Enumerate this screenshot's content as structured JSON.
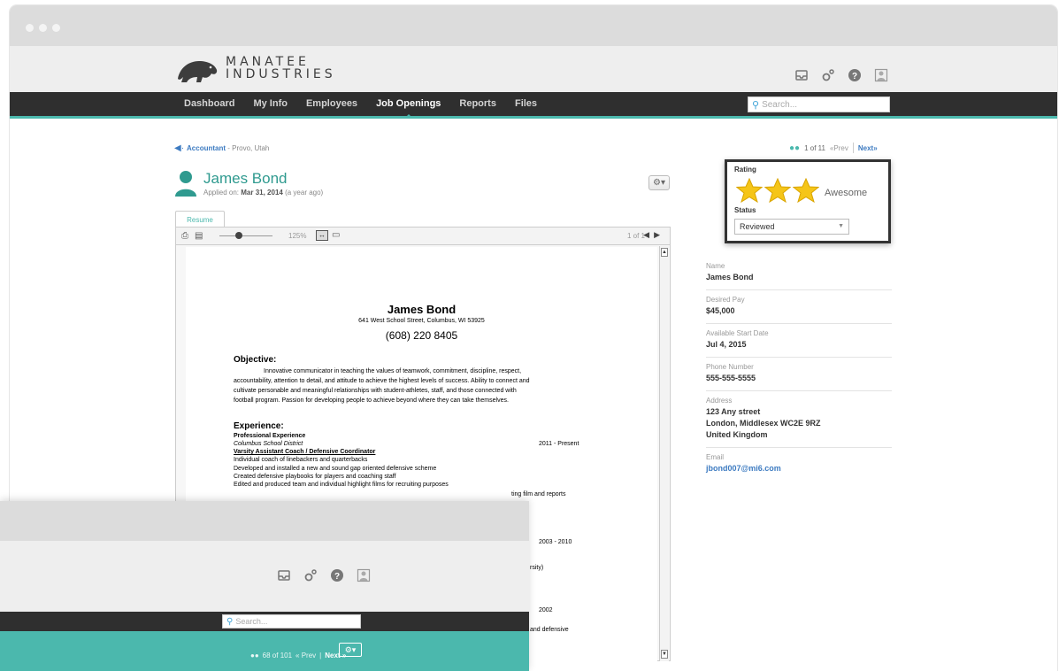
{
  "app": {
    "brand_top": "MANATEE",
    "brand_bottom": "INDUSTRIES"
  },
  "nav": {
    "items": [
      "Dashboard",
      "My Info",
      "Employees",
      "Job Openings",
      "Reports",
      "Files"
    ],
    "active": "Job Openings",
    "search_placeholder": "Search..."
  },
  "breadcrumb": {
    "job": "Accountant",
    "location": " - Provo, Utah"
  },
  "pager": {
    "count": "1 of 11",
    "prev": "«Prev",
    "next": "Next»"
  },
  "candidate": {
    "name": "James Bond",
    "applied_label": "Applied on: ",
    "applied_date": "Mar 31, 2014",
    "applied_ago": " (a year ago)"
  },
  "tabs": {
    "resume": "Resume"
  },
  "viewer": {
    "zoom": "125%",
    "page": "1 of 1"
  },
  "resume": {
    "name": "James Bond",
    "address": "641 West School Street, Columbus, WI  53925",
    "phone": "(608) 220 8405",
    "objective_heading": "Objective:",
    "objective_lines": [
      "Innovative communicator in teaching the values of teamwork, commitment, discipline, respect,",
      "accountability, attention to detail, and attitude to achieve the highest levels of success. Ability to connect and",
      "cultivate personable and meaningful relationships with student-athletes, staff, and those connected with",
      "football program. Passion for developing people to achieve beyond where they can take themselves."
    ],
    "experience_heading": "Experience:",
    "prof_exp": "Professional Experience",
    "employer": "Columbus School District",
    "role": "Varsity Assistant Coach / Defensive Coordinator",
    "range1": "2011 - Present",
    "duties": [
      "Individual coach of linebackers and quarterbacks",
      "Developed and installed a new and sound gap oriented defensive scheme",
      "Created defensive playbooks for players and coaching staff",
      "Edited and produced team and individual highlight films for recruiting purposes"
    ],
    "fragment1": "ting film and reports",
    "range2": "2003 - 2010",
    "fragment2": "rsity)",
    "range3": "2002",
    "fragment3": "and defensive"
  },
  "details": {
    "name_label": "Name",
    "name": "James Bond",
    "pay_label": "Desired Pay",
    "pay": "$45,000",
    "start_label": "Available Start Date",
    "start": "Jul 4, 2015",
    "phone_label": "Phone Number",
    "phone": "555-555-5555",
    "address_label": "Address",
    "address1": "123 Any street",
    "address2": "London, Middlesex WC2E 9RZ",
    "address3": "United Kingdom",
    "email_label": "Email",
    "email": "jbond007@mi6.com"
  },
  "rating": {
    "label": "Rating",
    "stars": 3,
    "text": "Awesome",
    "status_label": "Status",
    "status_value": "Reviewed"
  },
  "overlay": {
    "search_placeholder": "Search...",
    "count": "68 of 101",
    "prev": "« Prev",
    "next": "Next »"
  },
  "colors": {
    "accent": "#4bb8ad",
    "nav_bg": "#2f2f2f",
    "link": "#3d7bc1",
    "star": "#f5c518"
  },
  "icons": [
    "inbox-icon",
    "settings-icon",
    "help-icon",
    "user-icon",
    "search-icon",
    "gear-icon",
    "people-icon",
    "back-arrow-icon",
    "print-icon",
    "document-icon",
    "fit-width-icon",
    "screen-icon",
    "star-icon"
  ]
}
